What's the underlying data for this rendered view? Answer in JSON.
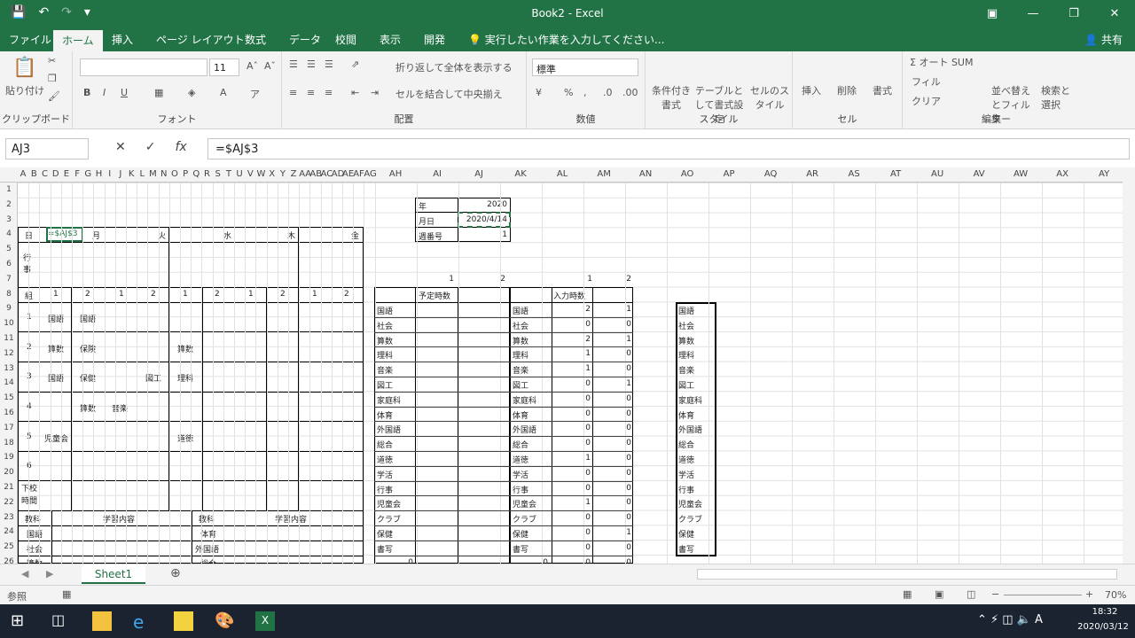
{
  "window": {
    "title": "Book2 - Excel",
    "controls": [
      "ribbon-display-icon",
      "minimize-icon",
      "restore-icon",
      "close-icon"
    ]
  },
  "tabs": [
    "ファイル",
    "ホーム",
    "挿入",
    "ページ レイアウト",
    "数式",
    "データ",
    "校閲",
    "表示",
    "開発"
  ],
  "tell_me": "実行したい作業を入力してください...",
  "share": "共有",
  "ribbon": {
    "clipboard": {
      "label": "クリップボード",
      "paste": "貼り付け"
    },
    "font": {
      "label": "フォント",
      "size": "11",
      "bold": "B",
      "italic": "I",
      "underline": "U"
    },
    "alignment": {
      "label": "配置",
      "wrap": "折り返して全体を表示する",
      "merge": "セルを結合して中央揃え"
    },
    "number": {
      "label": "数値",
      "format": "標準"
    },
    "styles": {
      "label": "スタイル",
      "conditional": "条件付き書式",
      "table": "テーブルとして書式設定",
      "cell": "セルのスタイル"
    },
    "cells": {
      "label": "セル",
      "insert": "挿入",
      "delete": "削除",
      "format": "書式"
    },
    "editing": {
      "label": "編集",
      "autosum": "オート SUM",
      "fill": "フィル",
      "clear": "クリア",
      "sort": "並べ替えとフィルター",
      "find": "検索と選択"
    }
  },
  "namebox": "AJ3",
  "formula": "=$AJ$3",
  "columns": [
    "A",
    "B",
    "C",
    "D",
    "E",
    "F",
    "G",
    "H",
    "I",
    "J",
    "K",
    "L",
    "M",
    "N",
    "O",
    "P",
    "Q",
    "R",
    "S",
    "T",
    "U",
    "V",
    "W",
    "X",
    "Y",
    "Z",
    "AA",
    "AB",
    "AC",
    "AD",
    "AE",
    "AF",
    "AG",
    "AH",
    "AI",
    "AJ",
    "AK",
    "AL",
    "AM",
    "AN",
    "AO",
    "AP",
    "AQ",
    "AR",
    "AS",
    "AT",
    "AU",
    "AV",
    "AW",
    "AX",
    "AY"
  ],
  "rows": [
    "1",
    "2",
    "3",
    "4",
    "5",
    "6",
    "7",
    "8",
    "9",
    "10",
    "11",
    "12",
    "13",
    "14",
    "15",
    "16",
    "17",
    "18",
    "19",
    "20",
    "21",
    "22",
    "23",
    "24",
    "25",
    "26"
  ],
  "schedule": {
    "day_label": "日",
    "cell_formula": "=$AJ$3",
    "days": [
      "月",
      "火",
      "水",
      "木",
      "金"
    ],
    "event_label": "行事",
    "group_label": "組",
    "group_nums": [
      "1",
      "2",
      "1",
      "2",
      "1",
      "2",
      "1",
      "2",
      "1",
      "2"
    ],
    "periods": [
      "1",
      "2",
      "3",
      "4",
      "5",
      "6"
    ],
    "after_school": "下校時間",
    "p1": [
      "国語",
      "国語"
    ],
    "p2": [
      "算数",
      "保険",
      "算数"
    ],
    "p3": [
      "国語",
      "保健",
      "図工",
      "理科"
    ],
    "p4": [
      "算数",
      "音楽"
    ],
    "p5": [
      "児童会",
      "道徳"
    ],
    "subject_head": [
      "教科",
      "学習内容",
      "教科",
      "学習内容"
    ],
    "subject_rows": [
      [
        "国語",
        "体育"
      ],
      [
        "社会",
        "外国語"
      ],
      [
        "算数",
        "総合"
      ]
    ]
  },
  "info": {
    "year_label": "年",
    "year": "2020",
    "date_label": "月日",
    "date": "2020/4/14",
    "week_label": "週番号",
    "week": "1"
  },
  "hours": {
    "row6_left": [
      "1",
      "2"
    ],
    "row6_right": [
      "1",
      "2"
    ],
    "planned": "予定時数",
    "entered": "入力時数",
    "subjects": [
      "国語",
      "社会",
      "算数",
      "理科",
      "音楽",
      "図工",
      "家庭科",
      "体育",
      "外国語",
      "総合",
      "道徳",
      "学活",
      "行事",
      "児童会",
      "クラブ",
      "保健",
      "書写"
    ],
    "al": [
      "2",
      "0",
      "2",
      "1",
      "1",
      "0",
      "0",
      "0",
      "0",
      "0",
      "1",
      "0",
      "0",
      "1",
      "0",
      "0",
      "0"
    ],
    "am": [
      "1",
      "0",
      "1",
      "0",
      "0",
      "1",
      "0",
      "0",
      "0",
      "0",
      "0",
      "0",
      "0",
      "0",
      "0",
      "1",
      "0"
    ],
    "row25": [
      "0",
      "0",
      "0",
      "0"
    ]
  },
  "sheet_tab": "Sheet1",
  "status": {
    "mode": "参照",
    "zoom": "70%"
  },
  "clock": {
    "time": "18:32",
    "date": "2020/03/12"
  }
}
